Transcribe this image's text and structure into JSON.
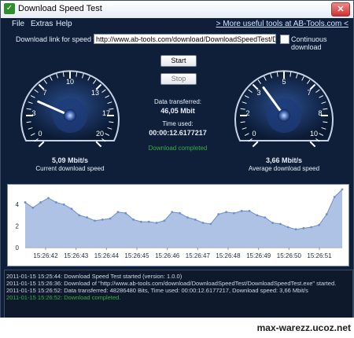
{
  "window": {
    "title": "Download Speed Test"
  },
  "menu": {
    "items": [
      "File",
      "Extras",
      "Help"
    ],
    "more_link": "> More useful tools at AB-Tools.com <"
  },
  "download": {
    "label": "Download link for speed test:",
    "url": "http://www.ab-tools.com/download/DownloadSpeedTest/DownloadSpeedTest",
    "continuous_label": "Continuous download",
    "continuous_checked": false
  },
  "buttons": {
    "start": "Start",
    "stop": "Stop"
  },
  "stats": {
    "data_transferred_label": "Data transferred:",
    "data_transferred_value": "46,05 Mbit",
    "time_used_label": "Time used:",
    "time_used_value": "00:00:12.6177217",
    "status": "Download completed"
  },
  "gauges": {
    "current": {
      "value_text": "5,09 Mbit/s",
      "label": "Current download speed",
      "value": 5.09,
      "max": 20,
      "ticks": [
        "0",
        "3",
        "7",
        "10",
        "13",
        "17",
        "20"
      ]
    },
    "average": {
      "value_text": "3,66 Mbit/s",
      "label": "Average download speed",
      "value": 3.66,
      "max": 10,
      "ticks": [
        "0",
        "2",
        "3",
        "5",
        "7",
        "8",
        "10"
      ]
    }
  },
  "chart_data": {
    "type": "area",
    "x": [
      "15:26:42",
      "15:26:43",
      "15:26:44",
      "15:26:45",
      "15:26:46",
      "15:26:47",
      "15:26:48",
      "15:26:49",
      "15:26:50",
      "15:26:51"
    ],
    "y_ticks": [
      "0",
      "2",
      "4"
    ],
    "ylim": [
      0,
      5.4
    ],
    "series": [
      {
        "values": [
          4.2,
          3.7,
          4.2,
          4.6,
          4.2,
          4.0,
          3.6,
          3.0,
          2.8,
          2.5,
          2.6,
          2.7,
          3.3,
          3.2,
          2.6,
          2.4,
          2.4,
          2.3,
          2.5,
          3.3,
          3.2,
          2.8,
          2.6,
          2.3,
          2.2,
          3.1,
          3.3,
          3.2,
          3.4,
          3.4,
          3.0,
          2.8,
          2.3,
          2.2,
          1.9,
          1.7,
          1.8,
          1.9,
          2.1,
          3.1,
          4.7,
          5.4
        ],
        "color": "#9fb7df"
      }
    ],
    "grid": false
  },
  "log": {
    "lines": [
      {
        "text": "2011-01-15 15:25:44: Download Speed Test started (version: 1.0.0)",
        "color": "#cfd9e6"
      },
      {
        "text": "2011-01-15 15:26:36: Download of \"http://www.ab-tools.com/download/DownloadSpeedTest/DownloadSpeedTest.exe\" started.",
        "color": "#cfd9e6"
      },
      {
        "text": "2011-01-15 15:26:52: Data transferred: 48286480 Bits, Time used: 00:00:12.6177217, Download speed: 3,66 Mbit/s",
        "color": "#cfd9e6"
      },
      {
        "text": "2011-01-15 15:26:52: Download completed.",
        "color": "#2fb33d"
      }
    ]
  },
  "watermark": "max-warezz.ucoz.net",
  "colors": {
    "status_green": "#2fb33d",
    "needle": "#ffffff",
    "chart_fill": "#9fb7df"
  }
}
